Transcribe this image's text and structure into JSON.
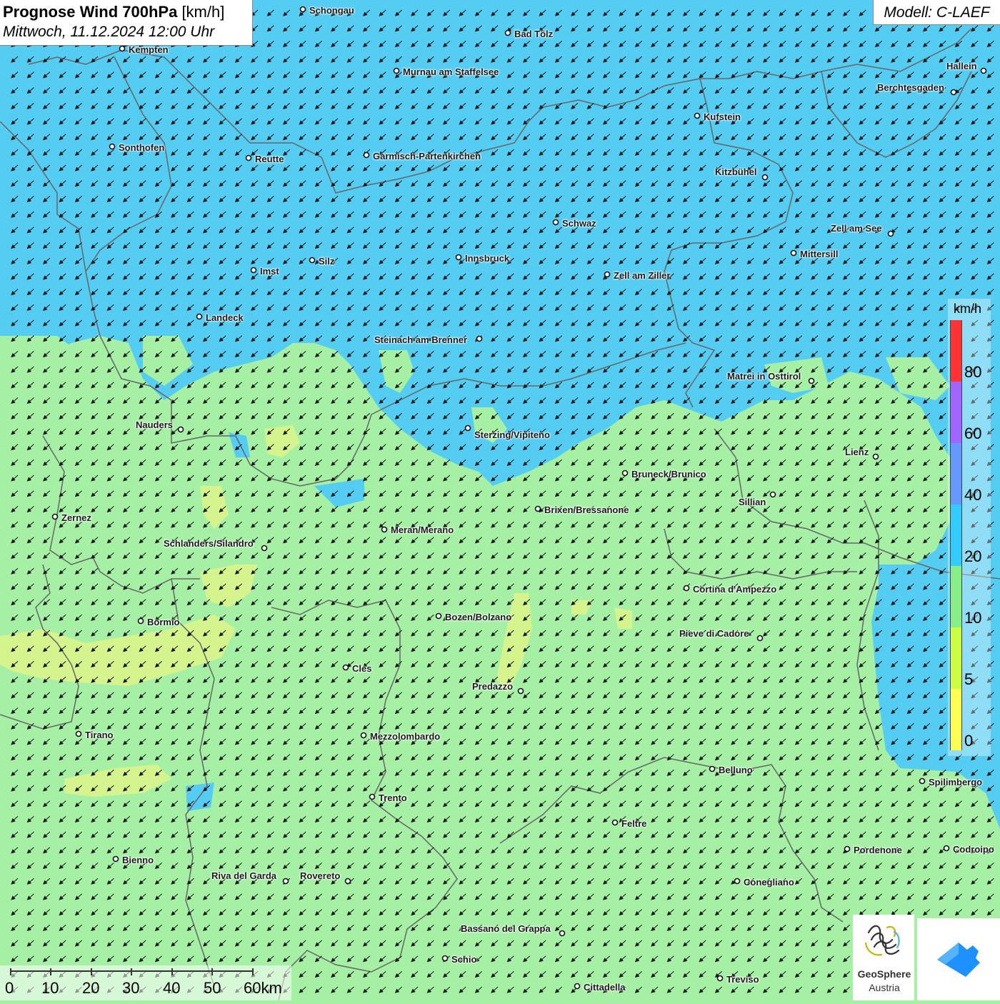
{
  "header": {
    "title_bold": "Prognose Wind 700hPa",
    "title_unit": "[km/h]",
    "datetime": "Mittwoch, 11.12.2024 12:00 Uhr"
  },
  "model_label": "Modell: C-LAEF",
  "legend": {
    "unit": "km/h",
    "ticks": [
      "80",
      "60",
      "40",
      "20",
      "10",
      "5",
      "0"
    ],
    "colors": [
      "#ff3333",
      "#a066ff",
      "#6699ff",
      "#33ccff",
      "#88ee88",
      "#ccff44",
      "#ffff55"
    ]
  },
  "scalebar": {
    "labels": [
      "0",
      "10",
      "20",
      "30",
      "40",
      "50",
      "60km"
    ]
  },
  "logos": {
    "geosphere_line1": "GeoSphere",
    "geosphere_line2": "Austria"
  },
  "colors": {
    "calm_green": "#a6f0a6",
    "wind_blue": "#55ccf2",
    "yellow_green": "#ddf58a",
    "border_gray": "#666666"
  },
  "cities": [
    {
      "name": "Schongau"
    },
    {
      "name": "Bad Tölz"
    },
    {
      "name": "Kempten"
    },
    {
      "name": "Murnau am Staffelsee"
    },
    {
      "name": "Hallein"
    },
    {
      "name": "Berchtesgaden"
    },
    {
      "name": "Kufstein"
    },
    {
      "name": "Sonthofen"
    },
    {
      "name": "Reutte"
    },
    {
      "name": "Garmisch-Partenkirchen"
    },
    {
      "name": "Kitzbühel"
    },
    {
      "name": "Schwaz"
    },
    {
      "name": "Zell am See"
    },
    {
      "name": "Mittersill"
    },
    {
      "name": "Imst"
    },
    {
      "name": "Silz"
    },
    {
      "name": "Innsbruck"
    },
    {
      "name": "Zell am Ziller"
    },
    {
      "name": "Landeck"
    },
    {
      "name": "Steinach am Brenner"
    },
    {
      "name": "Matrei in Osttirol"
    },
    {
      "name": "Nauders"
    },
    {
      "name": "Sterzing/Vipiteno"
    },
    {
      "name": "Lienz"
    },
    {
      "name": "Bruneck/Brunico"
    },
    {
      "name": "Sillian"
    },
    {
      "name": "Zernez"
    },
    {
      "name": "Brixen/Bressanone"
    },
    {
      "name": "Meran/Merano"
    },
    {
      "name": "Schlanders/Silandro"
    },
    {
      "name": "Cortina d'Ampezzo"
    },
    {
      "name": "Bozen/Bolzano"
    },
    {
      "name": "Bormio"
    },
    {
      "name": "Pieve di Cadore"
    },
    {
      "name": "Cles"
    },
    {
      "name": "Predazzo"
    },
    {
      "name": "Tirano"
    },
    {
      "name": "Mezzolombardo"
    },
    {
      "name": "Belluno"
    },
    {
      "name": "Spilimbergo"
    },
    {
      "name": "Trento"
    },
    {
      "name": "Feltre"
    },
    {
      "name": "Pordenone"
    },
    {
      "name": "Codroipo"
    },
    {
      "name": "Bienno"
    },
    {
      "name": "Riva del Garda"
    },
    {
      "name": "Rovereto"
    },
    {
      "name": "Conegliano"
    },
    {
      "name": "Bassano del Grappa"
    },
    {
      "name": "Schio"
    },
    {
      "name": "Treviso"
    },
    {
      "name": "Cittadella"
    }
  ]
}
